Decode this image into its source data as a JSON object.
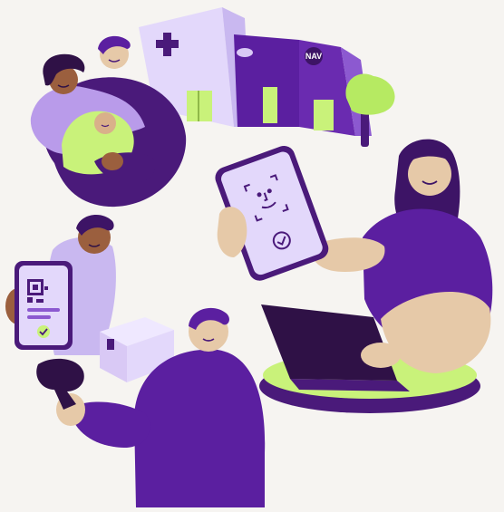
{
  "scene": {
    "building_sign": "NAV",
    "colors": {
      "background": "#f6f4f1",
      "purple_dark": "#4a1a7a",
      "purple_mid": "#5b1fa0",
      "purple_light": "#d9c9f5",
      "lavender": "#e3d8fb",
      "lime": "#c9f27a",
      "skin_light": "#e6c9a8",
      "skin_dark": "#9b5f3e",
      "laptop": "#2f1146"
    },
    "icons": [
      "medical-cross-icon",
      "face-id-icon",
      "checkmark-icon",
      "qr-code-icon",
      "tree-icon"
    ]
  }
}
